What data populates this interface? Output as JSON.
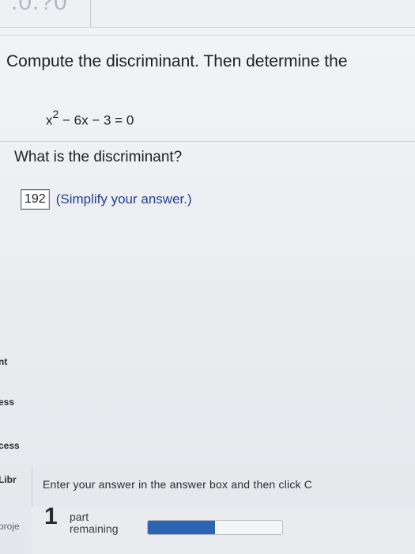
{
  "header": {
    "score_fragment": ".0.?0"
  },
  "question": {
    "prompt": "Compute the discriminant. Then determine the",
    "equation_base": "x",
    "equation_exponent": "2",
    "equation_rest": " − 6x − 3 = 0",
    "sub_prompt": "What is the discriminant?"
  },
  "answer": {
    "value": "192",
    "hint": "(Simplify your answer.)"
  },
  "sidebar": {
    "items": [
      {
        "label": "nt"
      },
      {
        "label": "ess"
      },
      {
        "label": "cess"
      },
      {
        "label": "Libr"
      },
      {
        "label": "proje"
      }
    ]
  },
  "footer": {
    "instruction": "Enter your answer in the answer box and then click C",
    "parts_count": "1",
    "parts_label": "part remaining",
    "progress_fraction": 0.5,
    "progress_color": "#2e64b4"
  }
}
